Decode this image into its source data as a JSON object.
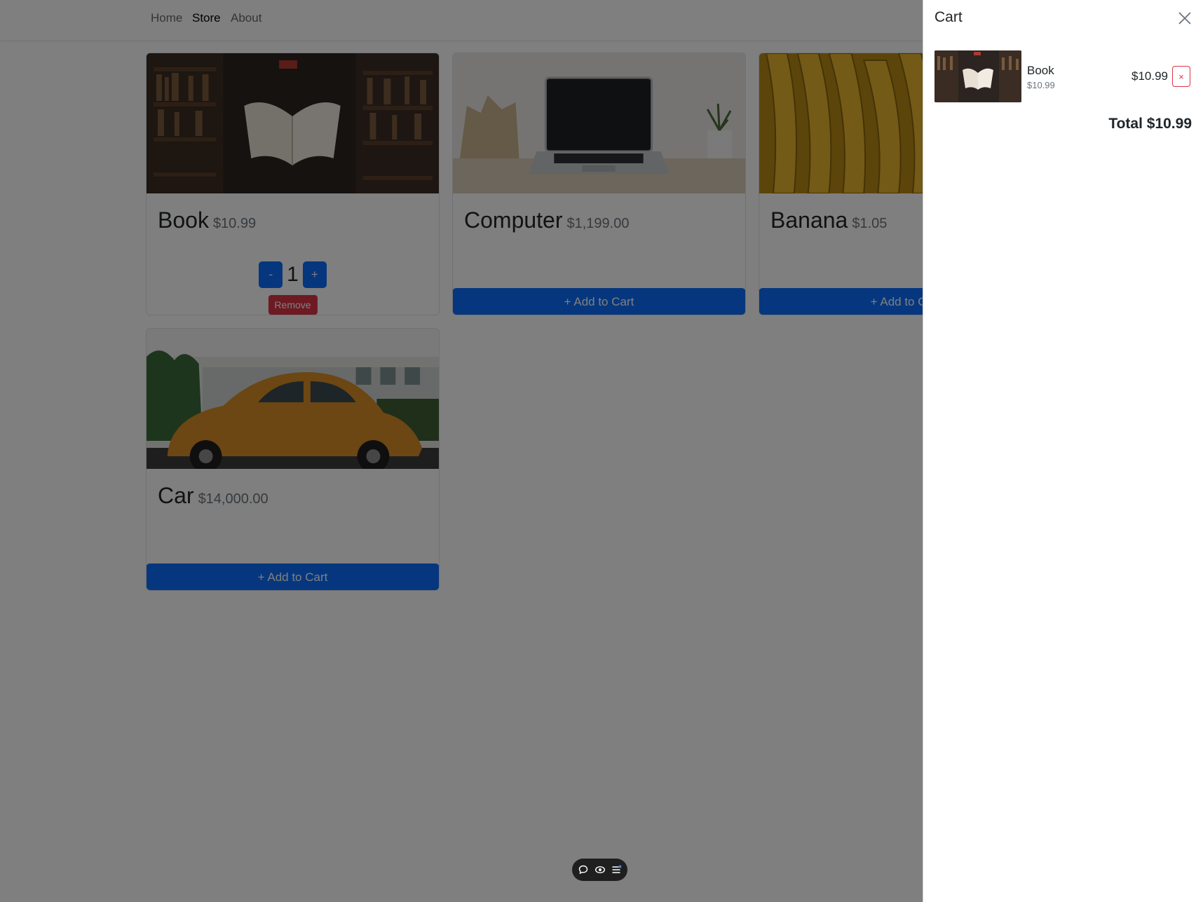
{
  "nav": {
    "links": [
      {
        "label": "Home",
        "active": false
      },
      {
        "label": "Store",
        "active": true
      },
      {
        "label": "About",
        "active": false
      }
    ]
  },
  "products": [
    {
      "name": "Book",
      "price": "$10.99",
      "image": "book-image",
      "in_cart": true,
      "quantity": "1",
      "minus_label": "-",
      "plus_label": "+",
      "remove_label": "Remove"
    },
    {
      "name": "Computer",
      "price": "$1,199.00",
      "image": "laptop-image",
      "in_cart": false,
      "add_label": "+ Add to Cart"
    },
    {
      "name": "Banana",
      "price": "$1.05",
      "image": "bananas-image",
      "in_cart": false,
      "add_label": "+ Add to Cart"
    },
    {
      "name": "Car",
      "price": "$14,000.00",
      "image": "car-image",
      "in_cart": false,
      "add_label": "+ Add to Cart"
    }
  ],
  "cart": {
    "title": "Cart",
    "close_icon": "close-icon",
    "items": [
      {
        "name": "Book",
        "unit_price": "$10.99",
        "line_total": "$10.99",
        "remove_label": "×"
      }
    ],
    "total": "Total $10.99"
  },
  "floating_toolbar": {
    "icons": [
      "comment-icon",
      "eye-icon",
      "list-icon"
    ]
  },
  "colors": {
    "primary": "#0d6efd",
    "danger": "#dc3545",
    "backdrop": "rgba(0,0,0,0.5)"
  }
}
